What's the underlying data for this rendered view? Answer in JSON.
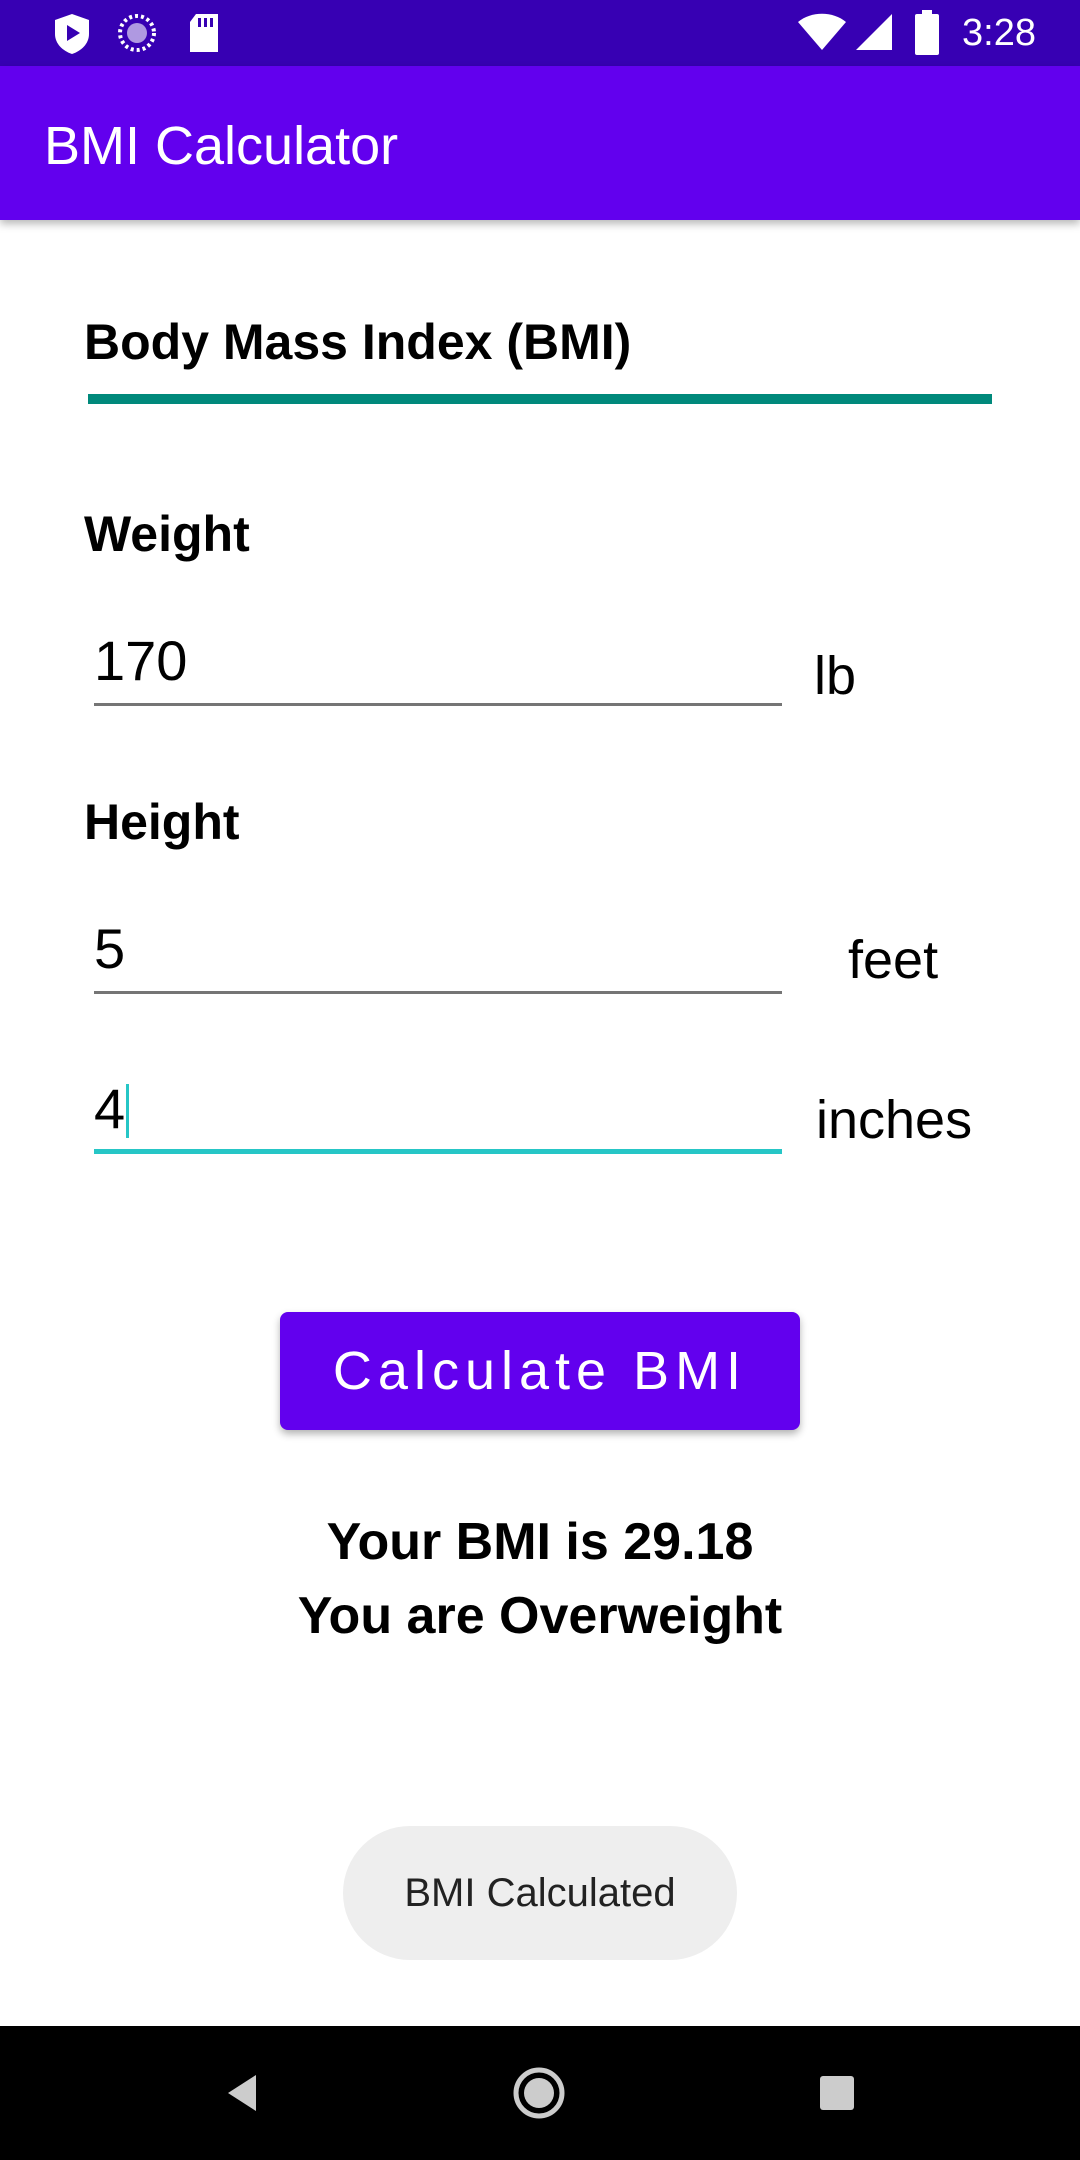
{
  "status_bar": {
    "time": "3:28",
    "icons": [
      "shield-play-icon",
      "sync-icon",
      "sd-card-icon",
      "wifi-icon",
      "signal-icon",
      "battery-icon"
    ]
  },
  "app_bar": {
    "title": "BMI Calculator",
    "color": "#6200ee"
  },
  "main": {
    "heading": "Body Mass Index (BMI)",
    "weight": {
      "label": "Weight",
      "value": "170",
      "unit": "lb"
    },
    "height": {
      "label": "Height",
      "feet": {
        "value": "5",
        "unit": "feet"
      },
      "inches": {
        "value": "4",
        "unit": "inches"
      }
    },
    "calculate_button": "Calculate BMI",
    "result_line1": "Your BMI is 29.18",
    "result_line2": "You are Overweight"
  },
  "toast": {
    "text": "BMI Calculated"
  },
  "nav_bar": {
    "icons": [
      "back-icon",
      "home-icon",
      "recents-icon"
    ]
  },
  "colors": {
    "status_bar": "#3700b3",
    "primary": "#6200ee",
    "heading_line": "#00897b",
    "focused_field": "#26c6c6"
  }
}
